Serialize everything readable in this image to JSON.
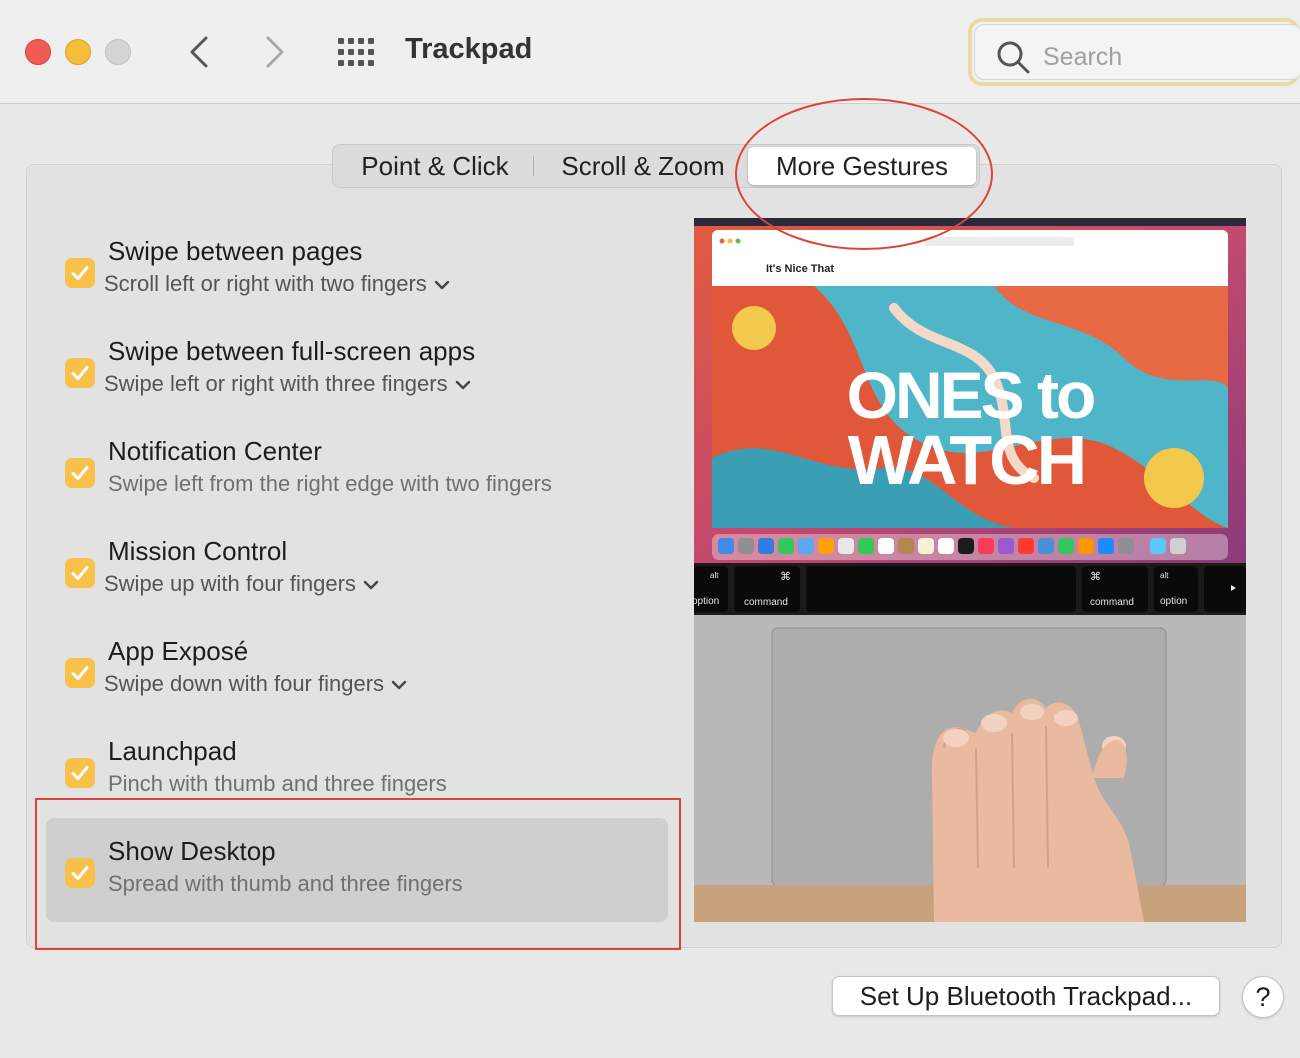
{
  "window": {
    "title": "Trackpad",
    "search_placeholder": "Search"
  },
  "tabs": [
    {
      "label": "Point & Click",
      "selected": false
    },
    {
      "label": "Scroll & Zoom",
      "selected": false
    },
    {
      "label": "More Gestures",
      "selected": true
    }
  ],
  "gestures": [
    {
      "title": "Swipe between pages",
      "subtitle": "Scroll left or right with two fingers",
      "checked": true,
      "has_dropdown": true
    },
    {
      "title": "Swipe between full-screen apps",
      "subtitle": "Swipe left or right with three fingers",
      "checked": true,
      "has_dropdown": true
    },
    {
      "title": "Notification Center",
      "subtitle": "Swipe left from the right edge with two fingers",
      "checked": true,
      "has_dropdown": false
    },
    {
      "title": "Mission Control",
      "subtitle": "Swipe up with four fingers",
      "checked": true,
      "has_dropdown": true
    },
    {
      "title": "App Exposé",
      "subtitle": "Swipe down with four fingers",
      "checked": true,
      "has_dropdown": true
    },
    {
      "title": "Launchpad",
      "subtitle": "Pinch with thumb and three fingers",
      "checked": true,
      "has_dropdown": false
    },
    {
      "title": "Show Desktop",
      "subtitle": "Spread with thumb and three fingers",
      "checked": true,
      "has_dropdown": false
    }
  ],
  "preview": {
    "headline_line1": "ONES to",
    "headline_line2": "WATCH",
    "site_name": "It's Nice That",
    "keys": {
      "alt": "alt",
      "option": "option",
      "command": "command",
      "cmd_symbol": "⌘"
    }
  },
  "footer": {
    "bluetooth_button": "Set Up Bluetooth Trackpad...",
    "help_button": "?"
  },
  "colors": {
    "checkbox": "#f7c14a",
    "annotation": "#d9453a",
    "selected_row": "#cfcfcf"
  }
}
